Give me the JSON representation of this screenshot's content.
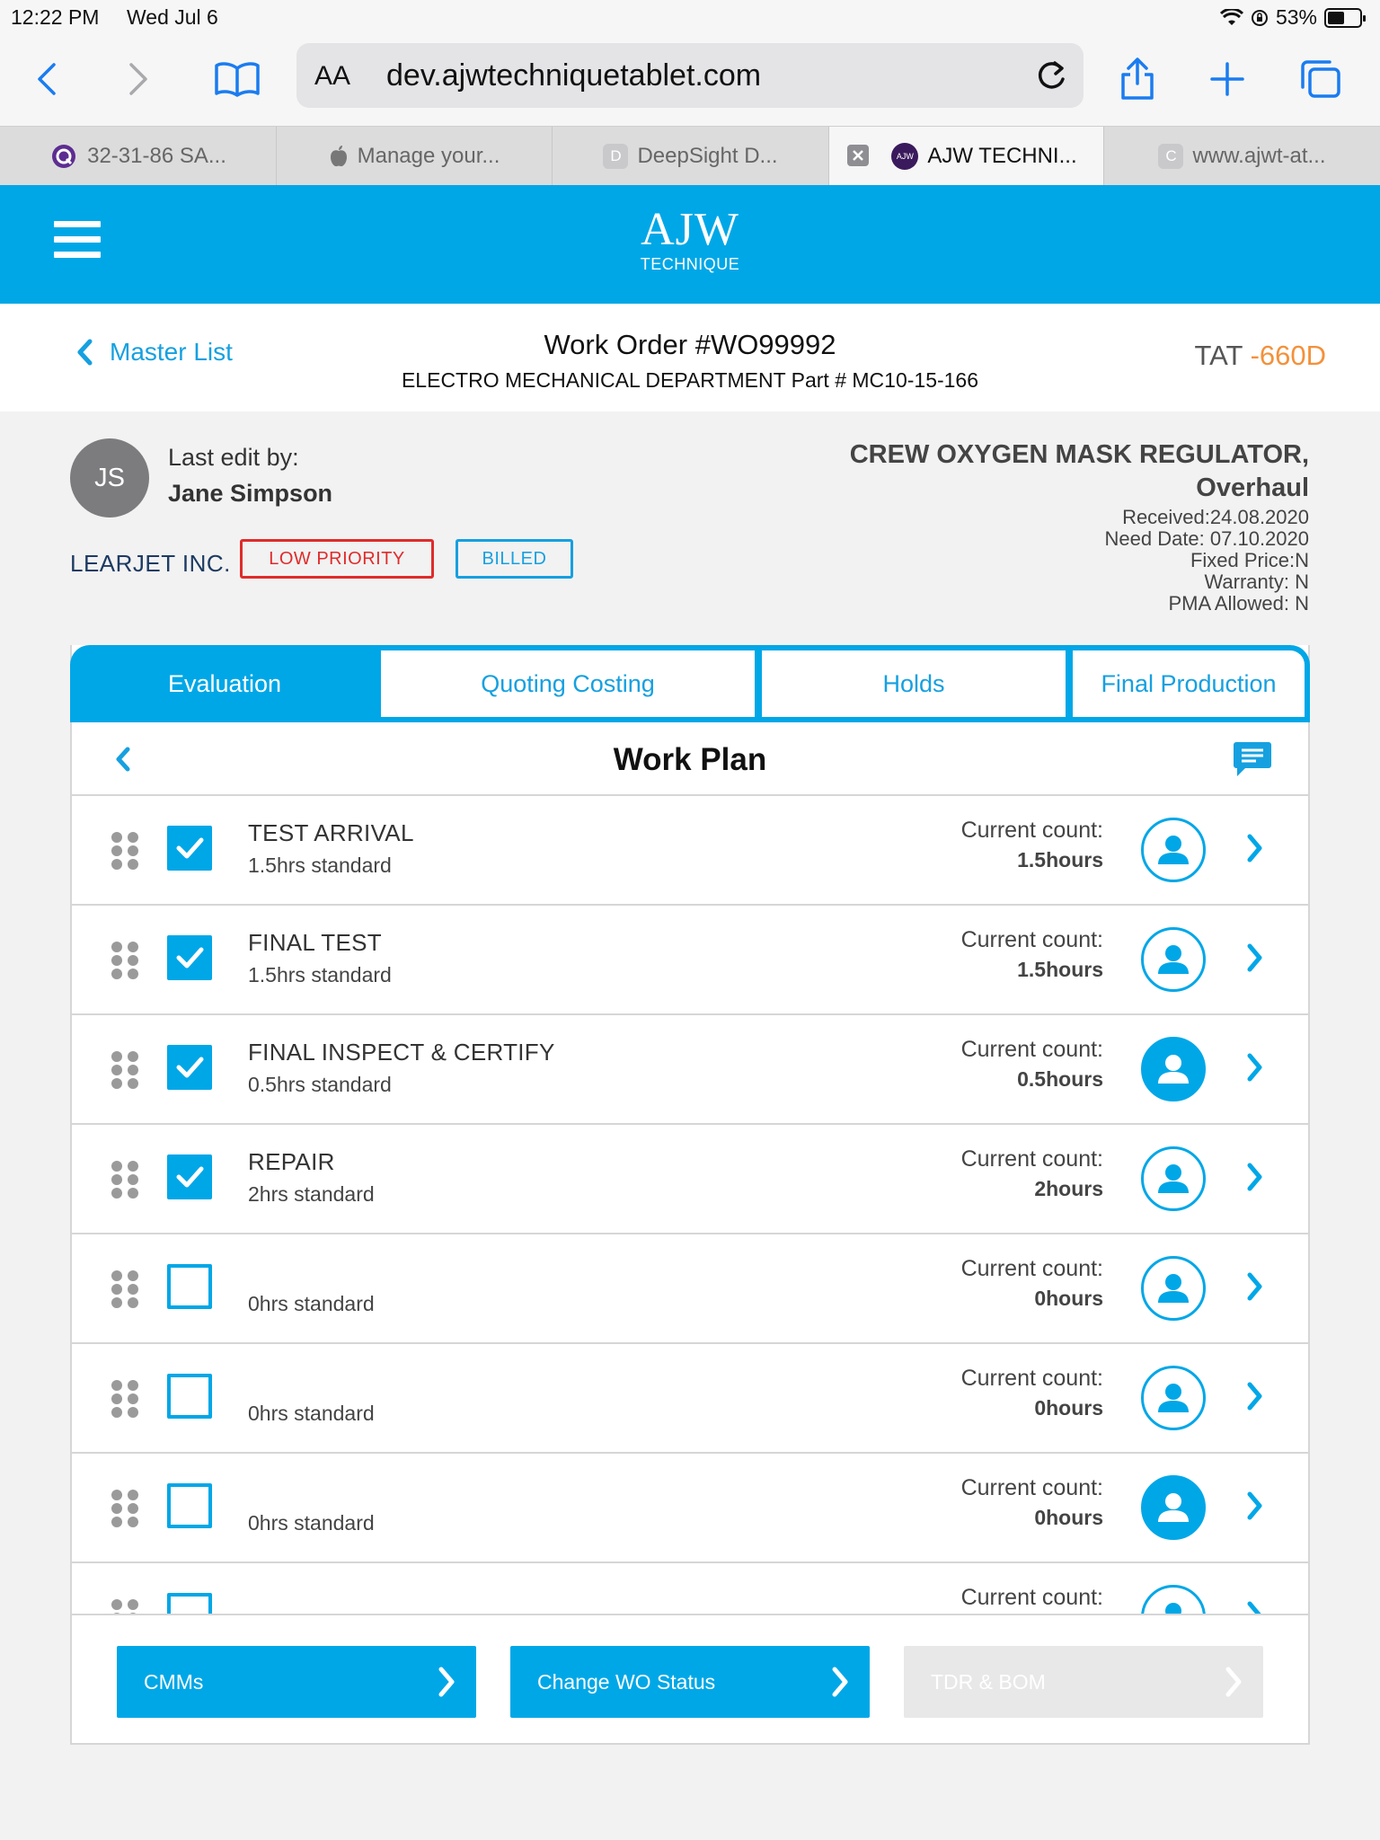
{
  "status_bar": {
    "time": "12:22 PM",
    "date": "Wed Jul 6",
    "battery": "53%",
    "battery_level": 0.53
  },
  "browser": {
    "url_aa": "AA",
    "url": "dev.ajwtechniquetablet.com",
    "tabs": [
      {
        "label": "32-31-86 SA...",
        "favicon": "Q"
      },
      {
        "label": "Manage your...",
        "favicon": "apple"
      },
      {
        "label": "DeepSight D...",
        "favicon": "D"
      },
      {
        "label": "AJW TECHNI...",
        "favicon": "AJW",
        "active": true
      },
      {
        "label": "www.ajwt-at...",
        "favicon": "C"
      }
    ]
  },
  "app": {
    "logo_main": "AJW",
    "logo_sub": "TECHNIQUE"
  },
  "work_order": {
    "back_label": "Master List",
    "title": "Work Order #WO99992",
    "subtitle": "ELECTRO MECHANICAL DEPARTMENT Part # MC10-15-166",
    "tat_label": "TAT",
    "tat_value": "-660D",
    "avatar_initials": "JS",
    "last_edit_label": "Last edit by:",
    "last_edit_name": "Jane Simpson",
    "customer": "LEARJET INC.",
    "priority_badge": "LOW PRIORITY",
    "billing_badge": "BILLED",
    "part_name_line1": "CREW OXYGEN MASK REGULATOR,",
    "part_name_line2": "Overhaul",
    "received": "Received:24.08.2020",
    "need_date": "Need Date: 07.10.2020",
    "fixed_price": "Fixed Price:N",
    "warranty": "Warranty: N",
    "pma_allowed": "PMA Allowed: N"
  },
  "tabs": [
    {
      "label": "Evaluation",
      "active": true
    },
    {
      "label": "Quoting Costing"
    },
    {
      "label": "Holds"
    },
    {
      "label": "Final Production"
    }
  ],
  "work_plan": {
    "title": "Work Plan",
    "count_label": "Current count:",
    "rows": [
      {
        "name": "TEST ARRIVAL",
        "standard": "1.5hrs standard",
        "count": "1.5hours",
        "checked": true,
        "assignee_filled": false
      },
      {
        "name": "FINAL TEST",
        "standard": "1.5hrs standard",
        "count": "1.5hours",
        "checked": true,
        "assignee_filled": false
      },
      {
        "name": "FINAL INSPECT & CERTIFY",
        "standard": "0.5hrs standard",
        "count": "0.5hours",
        "checked": true,
        "assignee_filled": true
      },
      {
        "name": "REPAIR",
        "standard": "2hrs standard",
        "count": "2hours",
        "checked": true,
        "assignee_filled": false
      },
      {
        "name": "",
        "standard": "0hrs standard",
        "count": "0hours",
        "checked": false,
        "assignee_filled": false
      },
      {
        "name": "",
        "standard": "0hrs standard",
        "count": "0hours",
        "checked": false,
        "assignee_filled": false
      },
      {
        "name": "",
        "standard": "0hrs standard",
        "count": "0hours",
        "checked": false,
        "assignee_filled": true
      },
      {
        "name": "",
        "standard": "",
        "count": "",
        "checked": false,
        "assignee_filled": false
      }
    ]
  },
  "footer": {
    "cmms_label": "CMMs",
    "change_status_label": "Change WO Status",
    "tdr_bom_label": "TDR & BOM"
  },
  "colors": {
    "accent": "#00a7e7",
    "tat": "#f3913b",
    "priority": "#e02b2b"
  }
}
